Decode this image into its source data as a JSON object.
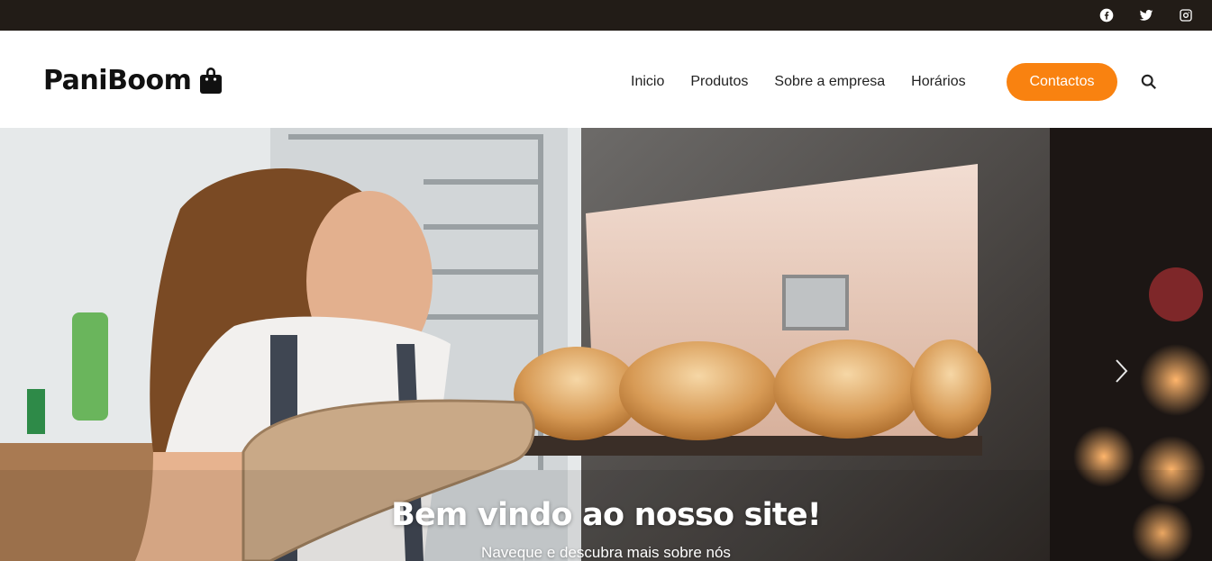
{
  "topbar": {
    "social": [
      {
        "icon": "facebook-icon"
      },
      {
        "icon": "twitter-icon"
      },
      {
        "icon": "instagram-icon"
      }
    ]
  },
  "brand": {
    "name": "PaniBoom",
    "icon": "shopping-bag-icon"
  },
  "nav": {
    "items": [
      "Inicio",
      "Produtos",
      "Sobre a empresa",
      "Horários"
    ],
    "cta": "Contactos",
    "search_icon": "search-icon"
  },
  "hero": {
    "title": "Bem vindo ao nosso site!",
    "subtitle": "Naveque e descubra mais sobre nós",
    "next_icon": "chevron-right-icon"
  },
  "colors": {
    "accent": "#f98210",
    "topbar": "#221c17"
  }
}
